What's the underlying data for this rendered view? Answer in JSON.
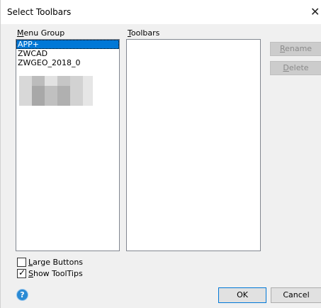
{
  "window": {
    "title": "Select Toolbars"
  },
  "menu_group": {
    "label_accel": "M",
    "label_rest": "enu Group",
    "items": [
      "APP+",
      "ZWCAD",
      "ZWGEO_2018_0"
    ],
    "selected_index": 0
  },
  "toolbars": {
    "label_accel": "T",
    "label_rest": "oolbars",
    "items": []
  },
  "buttons": {
    "rename_accel": "R",
    "rename_rest": "ename",
    "delete_accel": "D",
    "delete_rest": "elete",
    "ok": "OK",
    "cancel": "Cancel"
  },
  "options": {
    "large_buttons_accel": "L",
    "large_buttons_rest": "arge Buttons",
    "large_buttons_checked": false,
    "show_tooltips_accel": "S",
    "show_tooltips_rest": "how ToolTips",
    "show_tooltips_checked": true
  },
  "icons": {
    "help": "help-icon",
    "close": "close-icon",
    "check": "check-icon"
  }
}
